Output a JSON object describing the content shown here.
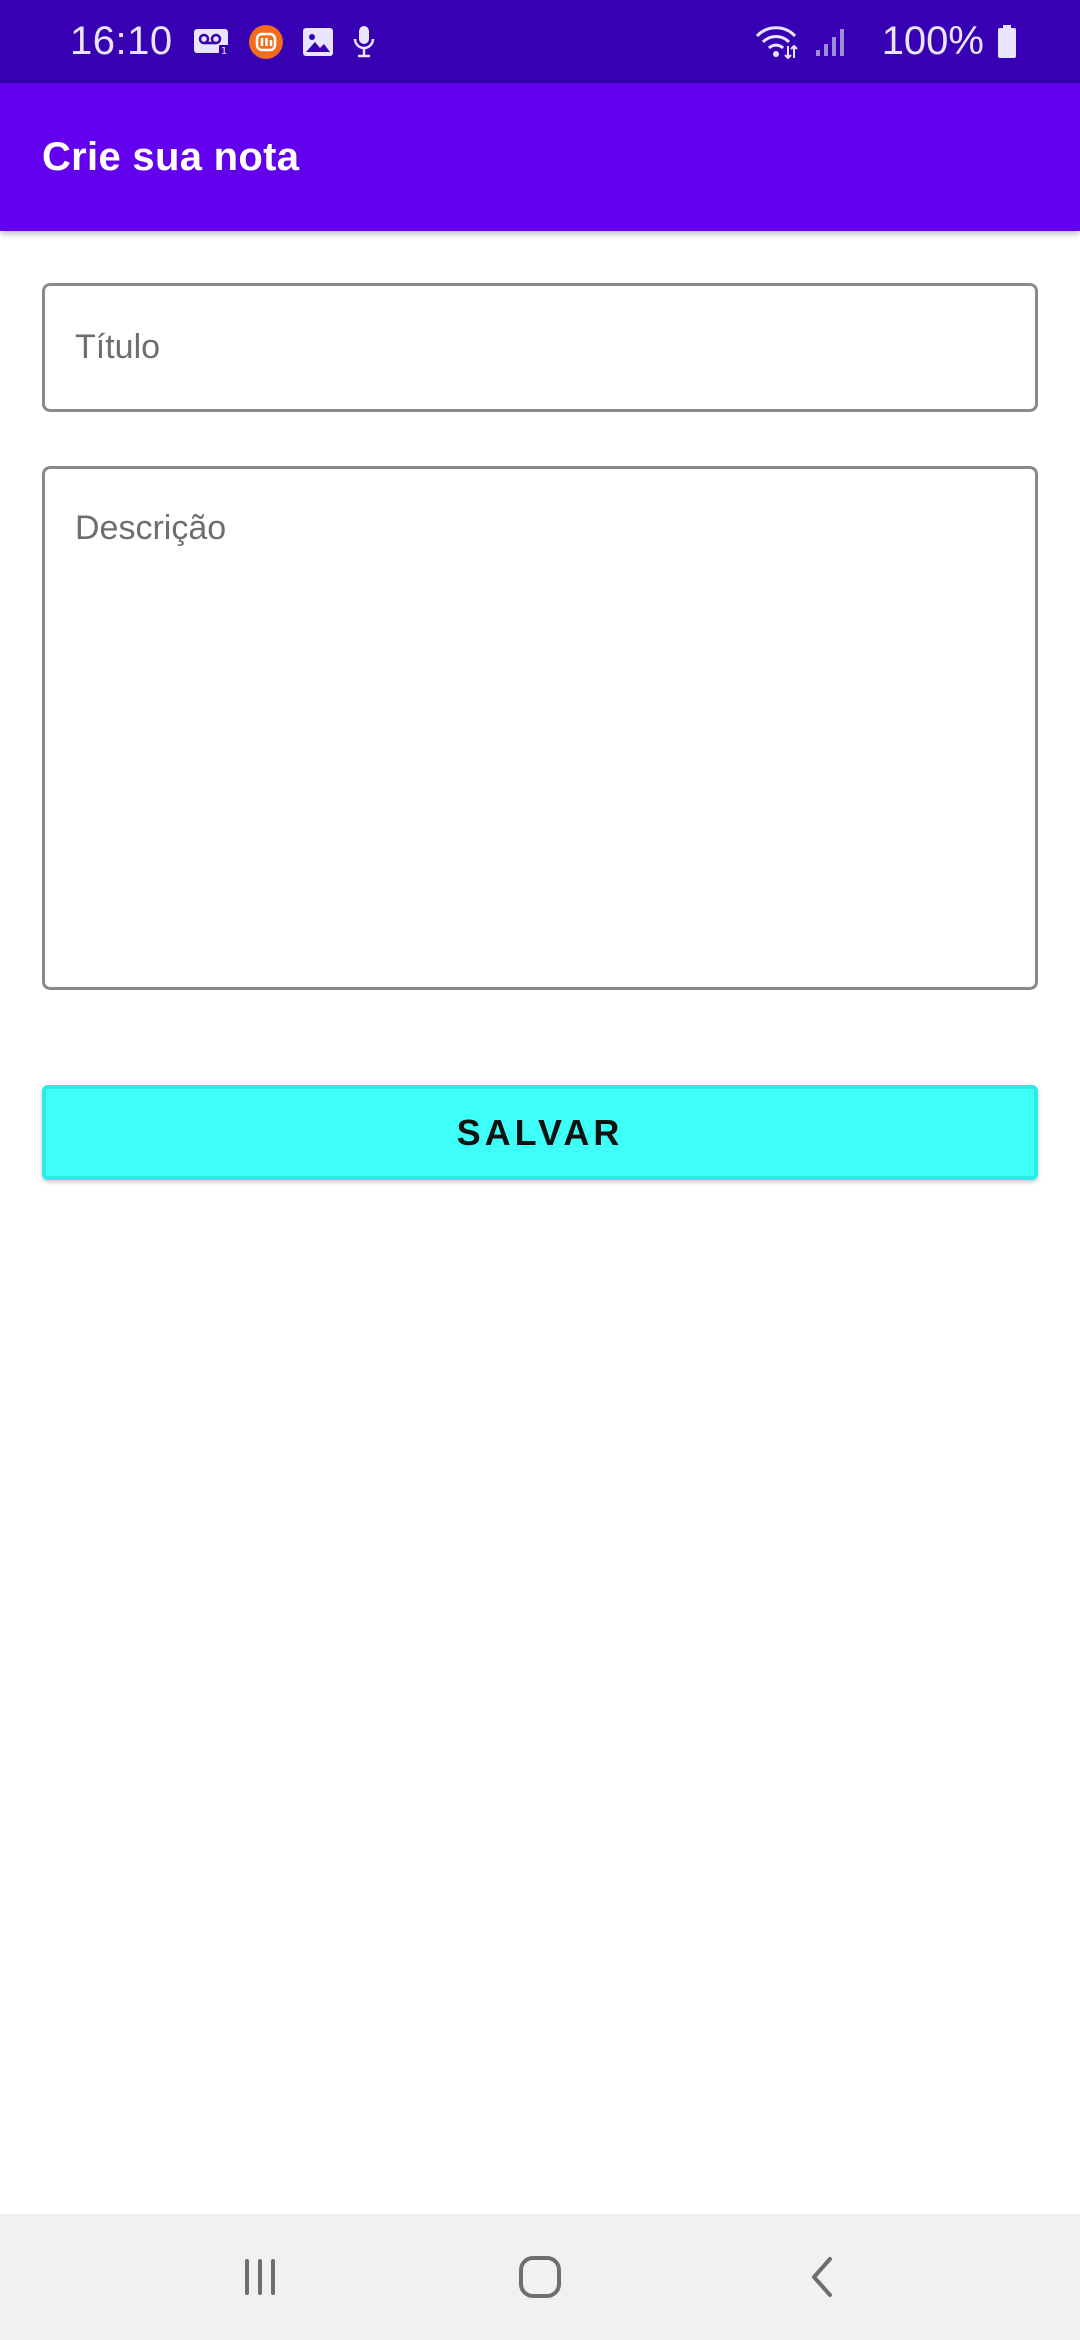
{
  "status_bar": {
    "time": "16:10",
    "battery_percent": "100%",
    "icons": [
      "voicemail-icon",
      "mi-app-icon",
      "gallery-icon",
      "microphone-icon",
      "wifi-icon",
      "signal-icon",
      "battery-icon"
    ]
  },
  "app_bar": {
    "title": "Crie sua nota",
    "color": "#6200ee"
  },
  "form": {
    "title_placeholder": "Título",
    "title_value": "",
    "description_placeholder": "Descrição",
    "description_value": "",
    "save_label": "SALVAR",
    "save_color": "#3dfff8"
  },
  "nav_bar": {
    "icons": [
      "recents-icon",
      "home-icon",
      "back-icon"
    ]
  }
}
